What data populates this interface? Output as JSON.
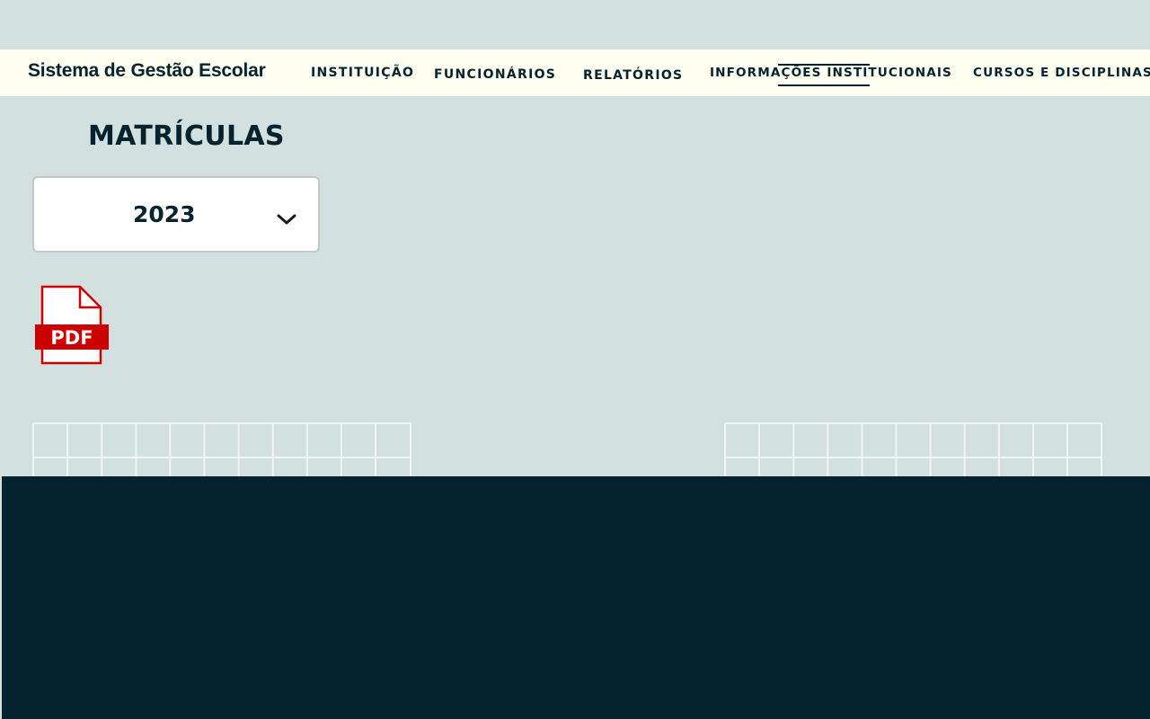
{
  "header": {
    "brand": "Sistema de Gestão Escolar",
    "nav": {
      "instituicao": "INSTITUIÇÃO",
      "funcionarios": "FUNCIONÁRIOS",
      "relatorios": "RELATÓRIOS",
      "informacoes": "INFORMAÇÕES INSTITUCIONAIS",
      "cursos": "CURSOS E DISCIPLINAS"
    },
    "active_item": "INFORMAÇÕES INSTITUCIONAIS"
  },
  "main": {
    "title": "MATRÍCULAS",
    "year_select": {
      "selected": "2023"
    },
    "pdf_icon": {
      "label": "PDF",
      "icon": "pdf-file-icon"
    }
  },
  "colors": {
    "background": "#d3e0e0",
    "navbar": "#fefff0",
    "dark": "#04232f",
    "pdf_red": "#cc0000"
  }
}
